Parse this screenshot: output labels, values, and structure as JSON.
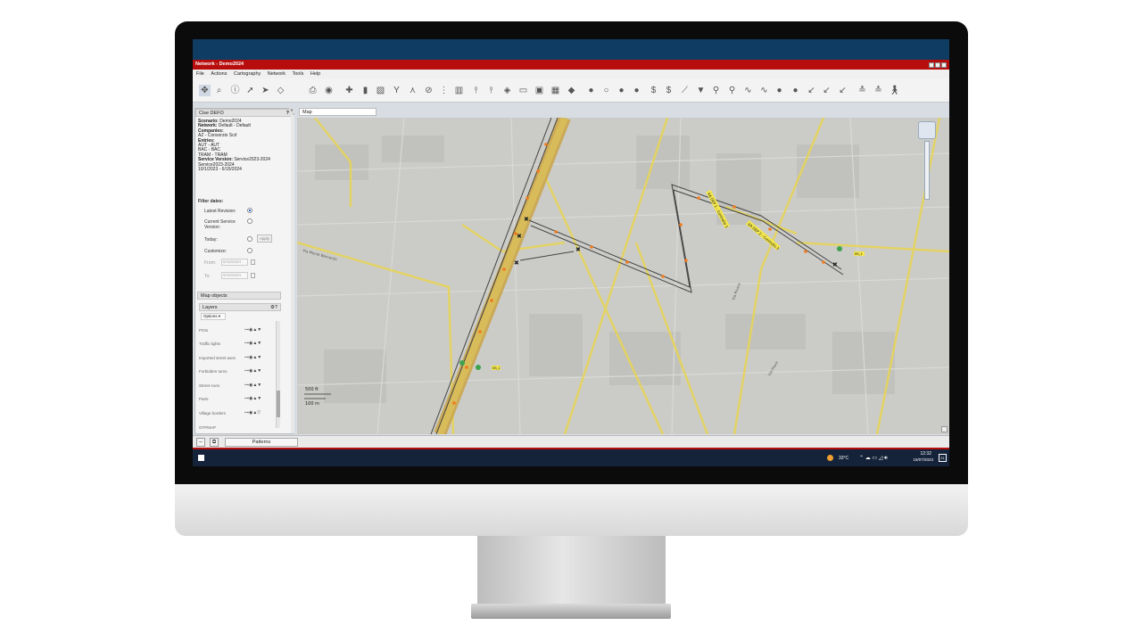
{
  "window": {
    "title": "Network - Demo2024"
  },
  "menu": [
    "File",
    "Actions",
    "Cartography",
    "Network",
    "Tools",
    "Help"
  ],
  "panel": {
    "title": "Cise DEFO",
    "help": "?",
    "scenario_label": "Scenario:",
    "scenario_value": "Demo2024",
    "network_label": "Network:",
    "network_value": "Default - Default",
    "companies_label": "Companies:",
    "companies_value": "AZ - Consorzio Scrl",
    "entries_label": "Entries:",
    "entries": [
      "AUT - AUT",
      "BAC - BAC",
      "TRAM - TRAM"
    ],
    "service_version_label": "Service Version:",
    "service_version_value": "Service2023-2024",
    "service_line2": "Service2023-2024",
    "service_dates": "10/1/2023 - 6/15/2024",
    "filter_title": "Filter dates:",
    "latest_revision": "Latest Revision:",
    "current_service": "Current Service",
    "version": "Version:",
    "today": "Today:",
    "apply": "Apply",
    "customize": "Customize:",
    "from_label": "From:",
    "from_value": "6/15/2024",
    "to_label": "To:",
    "to_value": "6/15/2024",
    "map_objects": "Map objects",
    "layers_title": "Layers",
    "options": "Options ▾",
    "layers": [
      "POIs",
      "Traffic lights",
      "Imported street axes",
      "Forbidden turns",
      "Street Axes",
      "Parts",
      "Village borders",
      "OTPMAP"
    ]
  },
  "map_tab": "Map",
  "scale": {
    "ft": "500 ft",
    "m": "100 m"
  },
  "route_label": "KA DEP 1 - Controllo 1",
  "route_label2": "KA DEP 2 - Controllo 3",
  "street_labels": [
    "Via Monte Bernardo",
    "Via Rivara",
    "Via Piave"
  ],
  "marker_labels": [
    "EB_1",
    "EB_2"
  ],
  "bottom": {
    "tab": "Patterns"
  },
  "taskbar": {
    "temp": "33°C",
    "time": "12:32",
    "date": "15/07/2023",
    "badge": "21"
  },
  "colors": {
    "title_red": "#b80d0d",
    "top_blue": "#0e3c63",
    "road_yellow": "#e6d45a",
    "route_orange": "#f07a1c"
  }
}
